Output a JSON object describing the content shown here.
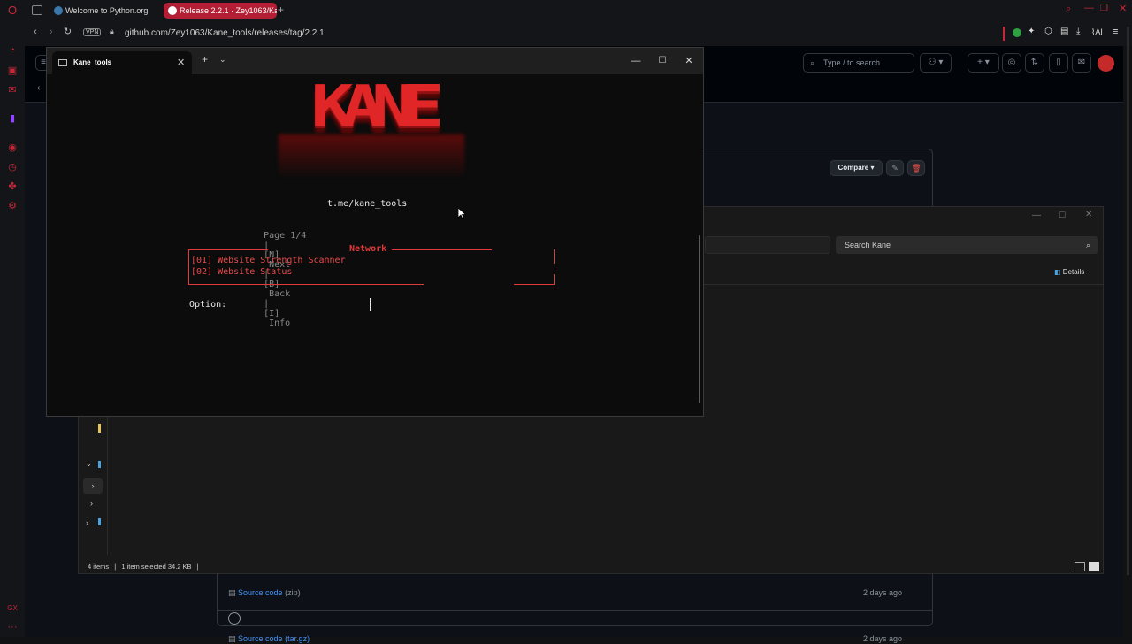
{
  "browser": {
    "tabs": [
      {
        "label": "Welcome to Python.org",
        "active": false
      },
      {
        "label": "Release 2.2.1 · Zey1063/Ka",
        "active": true
      }
    ],
    "new_tab": "+",
    "vpn_badge": "VPN",
    "url": "github.com/Zey1063/Kane_tools/releases/tag/2.2.1",
    "ai_label": "AI"
  },
  "github": {
    "search_placeholder": "Type / to search",
    "compare_label": "Compare",
    "assets": [
      {
        "name": "Source code",
        "ext": "(zip)",
        "time": "2 days ago"
      },
      {
        "name": "Source code",
        "ext": "(tar.gz)",
        "time": "2 days ago"
      }
    ]
  },
  "explorer": {
    "search_placeholder": "Search Kane",
    "details_label": "Details",
    "status": {
      "items": "4 items",
      "selected": "1 item selected",
      "size": "34.2 KB"
    }
  },
  "terminal": {
    "tab_title": "Kane_tools",
    "logo_text": "KANE",
    "link": "t.me/kane_tools",
    "nav_segments": [
      "Page 1/4",
      "|",
      "[N]",
      "Next",
      "|",
      "[B]",
      "Back",
      "|",
      "[I]",
      "Info"
    ],
    "menu_title": "Network",
    "menu_items": [
      "[01] Website Strength Scanner",
      "[02] Website Status"
    ],
    "prompt": "Option:"
  },
  "colors": {
    "accent_red": "#e23a3a",
    "terminal_bg": "#0c0c0c",
    "github_bg": "#0d1117"
  }
}
